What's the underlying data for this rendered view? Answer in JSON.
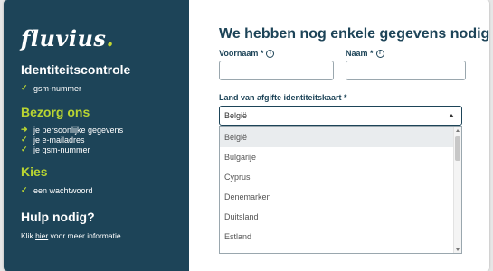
{
  "sidebar": {
    "logo": "fluvius",
    "logo_dot": ".",
    "sections": [
      {
        "title": "Identiteitscontrole",
        "items": [
          {
            "icon": "check-icon",
            "label": "gsm-nummer"
          }
        ]
      },
      {
        "title": "Bezorg ons",
        "items": [
          {
            "icon": "arrow-right-icon",
            "label": "je persoonlijke gegevens"
          },
          {
            "icon": "check-icon",
            "label": "je e-mailadres"
          },
          {
            "icon": "check-icon",
            "label": "je gsm-nummer"
          }
        ]
      },
      {
        "title": "Kies",
        "items": [
          {
            "icon": "check-icon",
            "label": "een wachtwoord"
          }
        ]
      },
      {
        "title": "Hulp nodig?",
        "items": []
      }
    ],
    "help": {
      "prefix": "Klik ",
      "link": "hier",
      "suffix": " voor meer informatie"
    }
  },
  "main": {
    "heading": "We hebben nog enkele gegevens nodig",
    "firstname_label": "Voornaam *",
    "lastname_label": "Naam *",
    "country_label": "Land van afgifte identiteitskaart *",
    "country_selected": "België",
    "country_options": [
      "België",
      "Bulgarije",
      "Cyprus",
      "Denemarken",
      "Duitsland",
      "Estland"
    ]
  },
  "colors": {
    "sidebar_bg": "#1d4458",
    "accent_green": "#b8d432",
    "heading": "#1d4458"
  }
}
